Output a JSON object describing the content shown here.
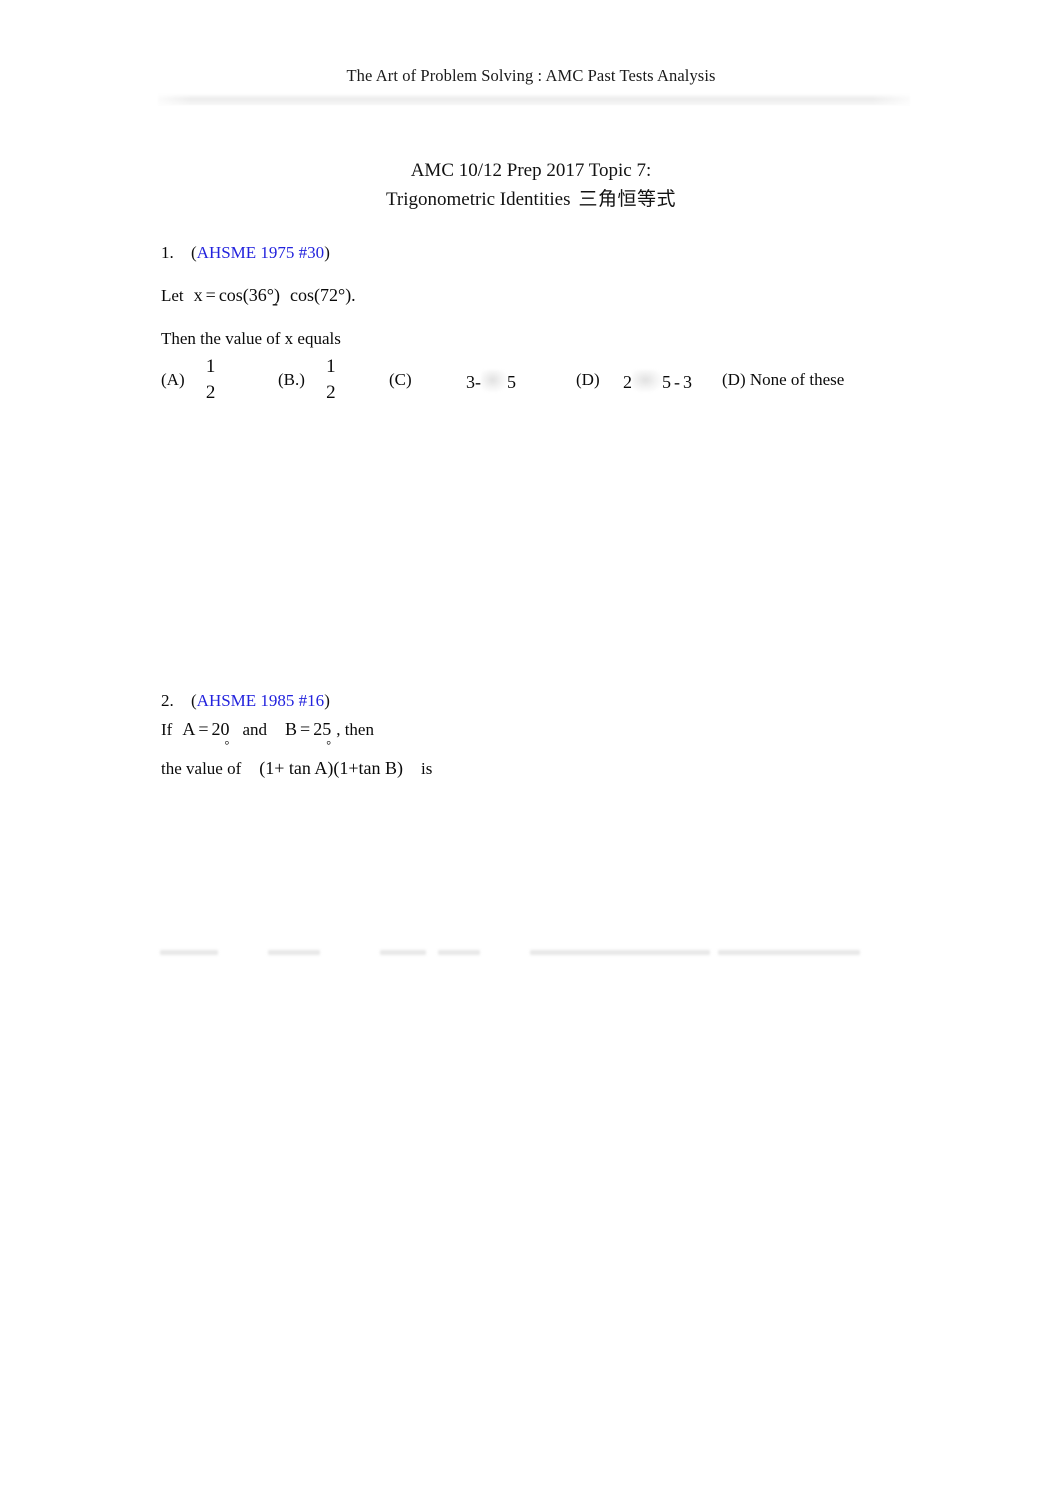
{
  "header": {
    "running_title": "The Art of Problem Solving : AMC Past Tests Analysis"
  },
  "doc_title": {
    "line1": "AMC 10/12    Prep 2017 Topic 7:",
    "line2_en": "Trigonometric Identities",
    "line2_cjk": "三角恒等式"
  },
  "colors": {
    "link_blue": "#2222dd",
    "body_text": "#0a0a0a",
    "rule_gray": "#ececec"
  },
  "problems": [
    {
      "number": "1.",
      "source_open_paren": "(",
      "source": "AHSME 1975 #30",
      "source_close_paren": ")",
      "statement_lead": "Let",
      "expr_x": "x",
      "expr_equals": "=",
      "expr_cos1": "cos(36°",
      "expr_cos1_close": ")",
      "expr_minus": "-",
      "expr_cos2": "cos(72°",
      "expr_cos2_close": ").",
      "question": "Then the value of x equals",
      "choices": [
        {
          "label": "(A)",
          "kind": "fraction",
          "numerator": "1",
          "denominator": "2"
        },
        {
          "label": "(B.)",
          "kind": "fraction",
          "numerator": "1",
          "denominator": "2"
        },
        {
          "label": "(C)",
          "kind": "radical",
          "prefix": "3",
          "operator": "-",
          "radicand": "5"
        },
        {
          "label": "(D)",
          "kind": "radical_coeff",
          "coefficient": "2",
          "radicand": "5",
          "operator": "-",
          "suffix": "3"
        },
        {
          "label": "(D)",
          "kind": "text",
          "text": "None of these"
        }
      ]
    },
    {
      "number": "2.",
      "source_open_paren": "(",
      "source": "AHSME 1985 #16",
      "source_close_paren": ")",
      "statement_lead": "If",
      "var_a": "A",
      "var_a_equals": "=",
      "var_a_value": "20",
      "var_a_deg": "°",
      "conjunction": "and",
      "var_b": "B",
      "var_b_equals": "=",
      "var_b_value": "25",
      "var_b_deg": "°",
      "comma_then": ", then",
      "value_lead": "the value of",
      "expression": "(1+ tan A)(1+tan B)",
      "value_tail": "is"
    }
  ]
}
